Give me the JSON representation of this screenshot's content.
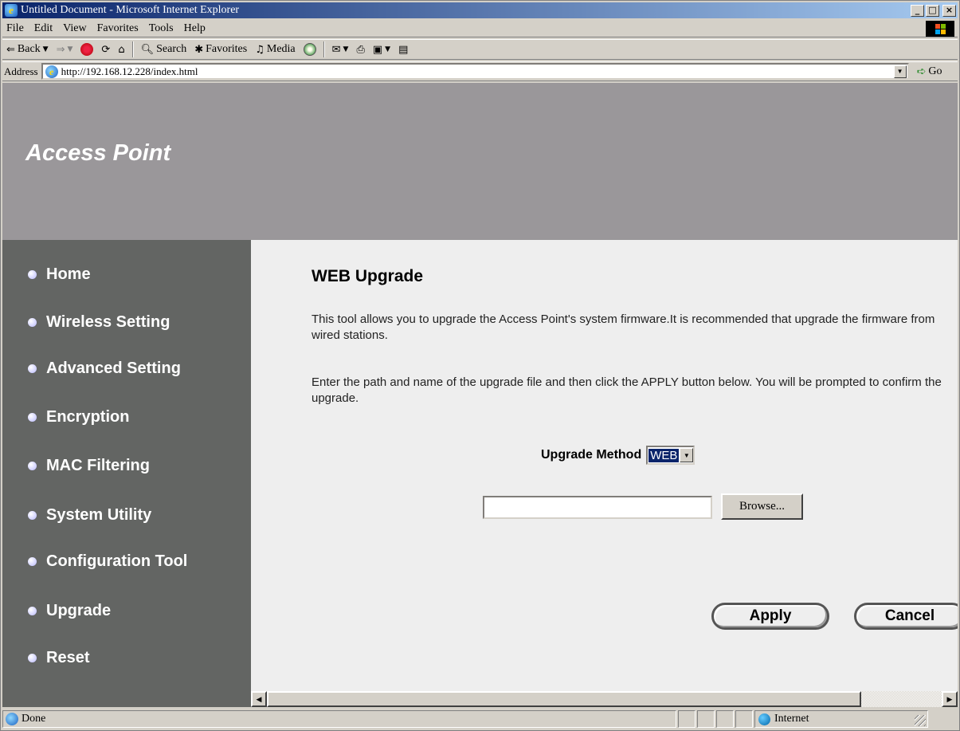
{
  "window": {
    "title": "Untitled Document - Microsoft Internet Explorer",
    "minimize": "_",
    "maximize": "□",
    "close": "×"
  },
  "menu": [
    {
      "label": "File"
    },
    {
      "label": "Edit"
    },
    {
      "label": "View"
    },
    {
      "label": "Favorites"
    },
    {
      "label": "Tools"
    },
    {
      "label": "Help"
    }
  ],
  "toolbar": {
    "back": "Back",
    "search": "Search",
    "favorites": "Favorites",
    "media": "Media"
  },
  "address": {
    "label": "Address",
    "url": "http://192.168.12.228/index.html",
    "go": "Go"
  },
  "page": {
    "brand": "Access Point",
    "nav": [
      "Home",
      "Wireless Setting",
      "Advanced Setting",
      "Encryption",
      "MAC Filtering",
      "System Utility",
      "Configuration Tool",
      "Upgrade",
      "Reset"
    ],
    "heading": "WEB Upgrade",
    "para1": "This tool allows you to upgrade the Access Point's system firmware.It is recommended that upgrade the firmware from wired stations.",
    "para2": "Enter the path and name of the upgrade file and then click the APPLY button below. You will be prompted to confirm the upgrade.",
    "method_label": "Upgrade Method",
    "method_value": "WEB",
    "file_value": "",
    "browse_label": "Browse...",
    "apply_label": "Apply",
    "cancel_label": "Cancel"
  },
  "status": {
    "text": "Done",
    "zone": "Internet"
  },
  "colors": {
    "banner": "#9a979a",
    "sidebar": "#636563",
    "content": "#eeeeee",
    "titlebar_start": "#0a246a"
  }
}
